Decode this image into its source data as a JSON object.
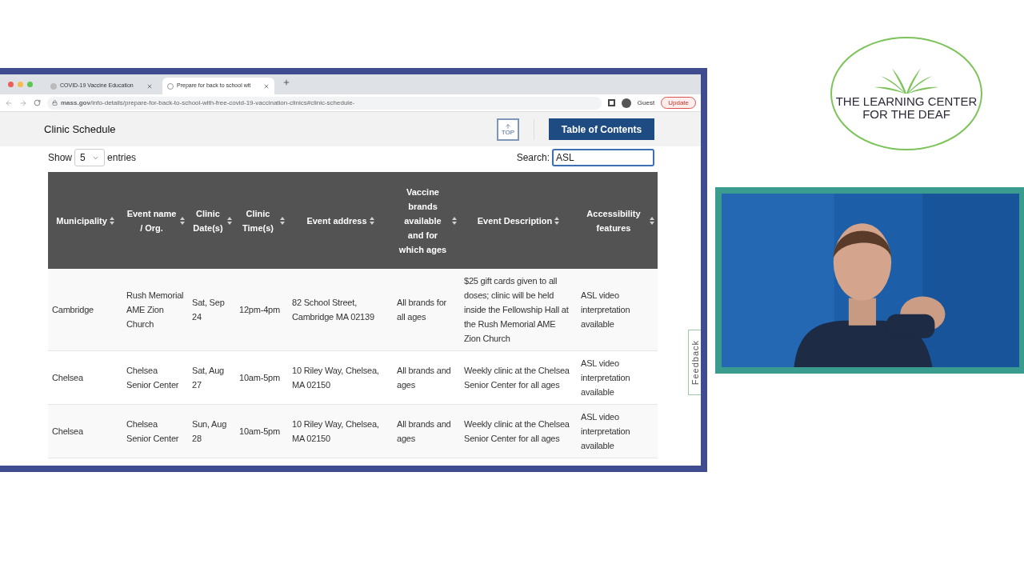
{
  "browser": {
    "tabs": [
      {
        "title": "COVID-19 Vaccine Education",
        "selected": false
      },
      {
        "title": "Prepare for back to school wit",
        "selected": true
      }
    ],
    "url": "**mass.gov**/info-details/prepare-for-back-to-school-with-free-covid-19-vaccination-clinics#clinic-schedule-",
    "profile": "Guest",
    "update": "Update"
  },
  "page": {
    "section_title": "Clinic Schedule",
    "top_label": "TOP",
    "toc_button": "Table of Contents",
    "show_label": "Show",
    "entries_value": "5",
    "entries_label": "entries",
    "search_label": "Search:",
    "search_value": "ASL",
    "table": {
      "columns": [
        "Municipality",
        "Event name / Org.",
        "Clinic Date(s)",
        "Clinic Time(s)",
        "Event address",
        "Vaccine brands available and for which ages",
        "Event Description",
        "Accessibility features"
      ],
      "rows": [
        [
          "Cambridge",
          "Rush Memorial AME Zion Church",
          "Sat, Sep 24",
          "12pm-4pm",
          "82 School Street, Cambridge MA 02139",
          "All brands for all ages",
          "$25 gift cards given to all doses; clinic will be held inside the Fellowship Hall at the Rush Memorial AME Zion Church",
          "ASL video interpretation available"
        ],
        [
          "Chelsea",
          "Chelsea Senior Center",
          "Sat, Aug 27",
          "10am-5pm",
          "10 Riley Way, Chelsea, MA 02150",
          "All brands and ages",
          "Weekly clinic at the Chelsea Senior Center for all ages",
          "ASL video interpretation available"
        ],
        [
          "Chelsea",
          "Chelsea Senior Center",
          "Sun, Aug 28",
          "10am-5pm",
          "10 Riley Way, Chelsea, MA 02150",
          "All brands and ages",
          "Weekly clinic at the Chelsea Senior Center for all ages",
          "ASL video interpretation available"
        ]
      ]
    },
    "feedback": "Feedback"
  },
  "logo": {
    "lines": [
      "THE LEARNING CENTER",
      "FOR THE DEAF"
    ]
  }
}
